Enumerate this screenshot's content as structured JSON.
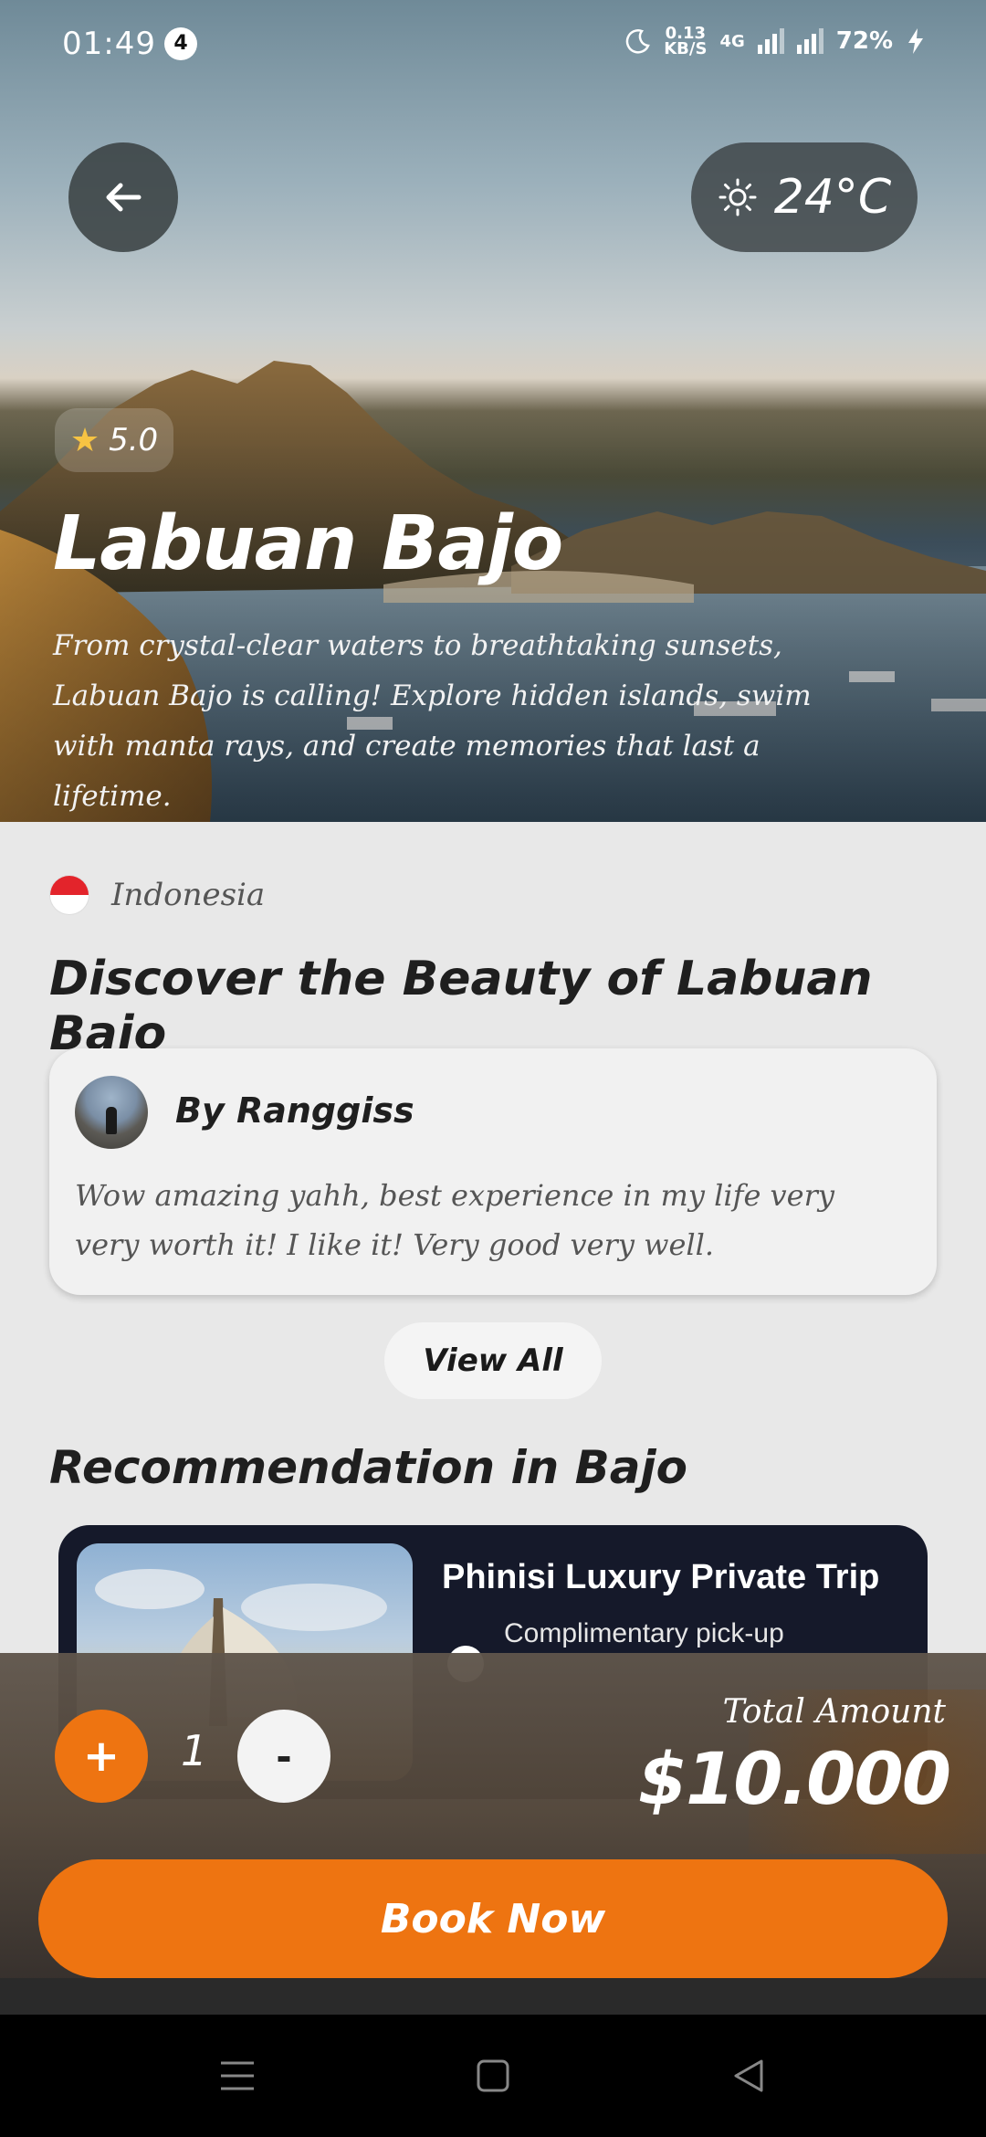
{
  "status_bar": {
    "time": "01:49",
    "notification_count": "4",
    "net_speed_value": "0.13",
    "net_speed_unit": "KB/S",
    "network_type": "4G",
    "battery": "72%"
  },
  "hero": {
    "temperature": "24°C",
    "rating": "5.0",
    "title": "Labuan Bajo",
    "description": "From crystal-clear waters to breathtaking sunsets, Labuan Bajo is calling! Explore hidden islands, swim with manta rays, and create memories that last a lifetime."
  },
  "country": {
    "name": "Indonesia"
  },
  "discover": {
    "title": "Discover the Beauty of Labuan Bajo"
  },
  "review": {
    "reviewer": "By Ranggiss",
    "text": "Wow amazing yahh, best experience in my life very very worth it! I like it! Very good very well."
  },
  "view_all_label": "View All",
  "recommendation": {
    "title": "Recommendation in Bajo",
    "card": {
      "title": "Phinisi Luxury Private Trip",
      "feature": "Complimentary pick-up"
    }
  },
  "booking": {
    "plus_label": "+",
    "quantity": "1",
    "minus_label": "-",
    "total_label": "Total Amount",
    "total_amount": "$10.000",
    "book_label": "Book Now"
  },
  "colors": {
    "accent": "#ee7411",
    "card_dark": "#15192a"
  }
}
